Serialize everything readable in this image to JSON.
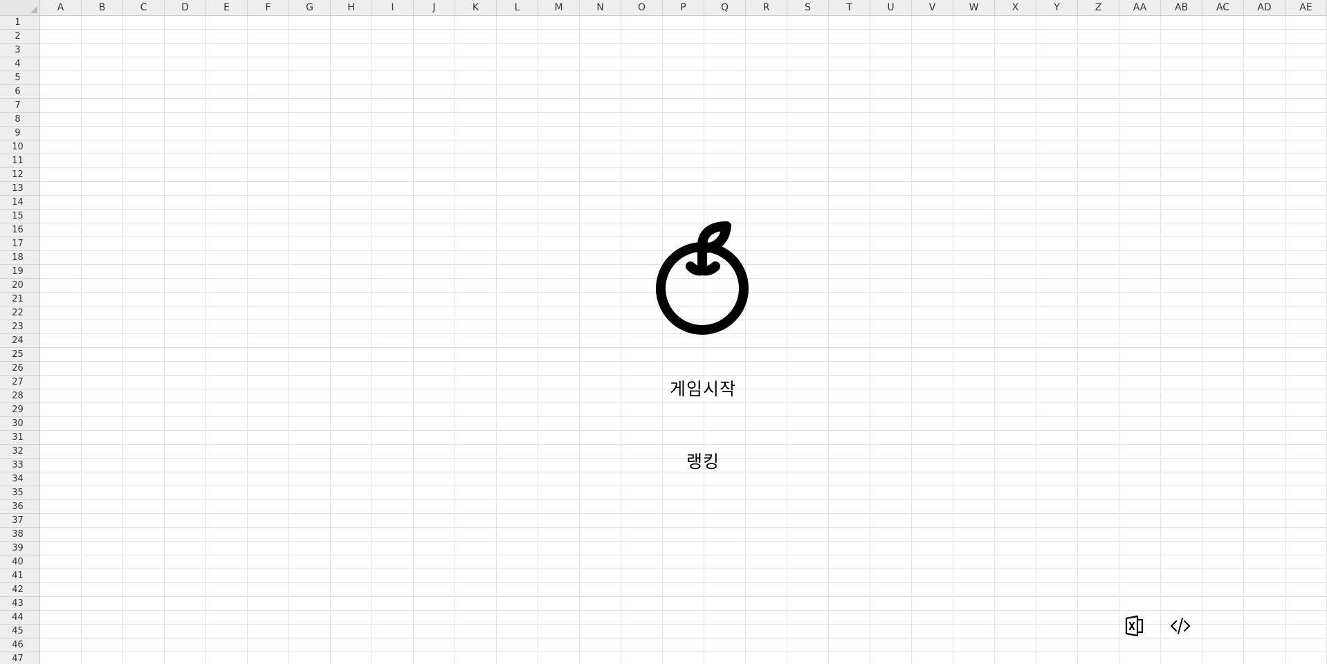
{
  "sheet": {
    "columns": [
      "A",
      "B",
      "C",
      "D",
      "E",
      "F",
      "G",
      "H",
      "I",
      "J",
      "K",
      "L",
      "M",
      "N",
      "O",
      "P",
      "Q",
      "R",
      "S",
      "T",
      "U",
      "V",
      "W",
      "X",
      "Y",
      "Z",
      "AA",
      "AB",
      "AC",
      "AD",
      "AE"
    ],
    "rows": [
      "1",
      "2",
      "3",
      "4",
      "5",
      "6",
      "7",
      "8",
      "9",
      "10",
      "11",
      "12",
      "13",
      "14",
      "15",
      "16",
      "17",
      "18",
      "19",
      "20",
      "21",
      "22",
      "23",
      "24",
      "25",
      "26",
      "27",
      "28",
      "29",
      "30",
      "31",
      "32",
      "33",
      "34",
      "35",
      "36",
      "37",
      "38",
      "39",
      "40",
      "41",
      "42",
      "43",
      "44",
      "45",
      "46",
      "47"
    ],
    "gridline_color": "#e1e1e1",
    "header_background": "#eeeeee"
  },
  "game_menu": {
    "logo_icon": "apple-icon",
    "start_label": "게임시작",
    "ranking_label": "랭킹"
  },
  "toolbar": {
    "excel_icon": "excel-icon",
    "code_icon": "code-icon"
  }
}
